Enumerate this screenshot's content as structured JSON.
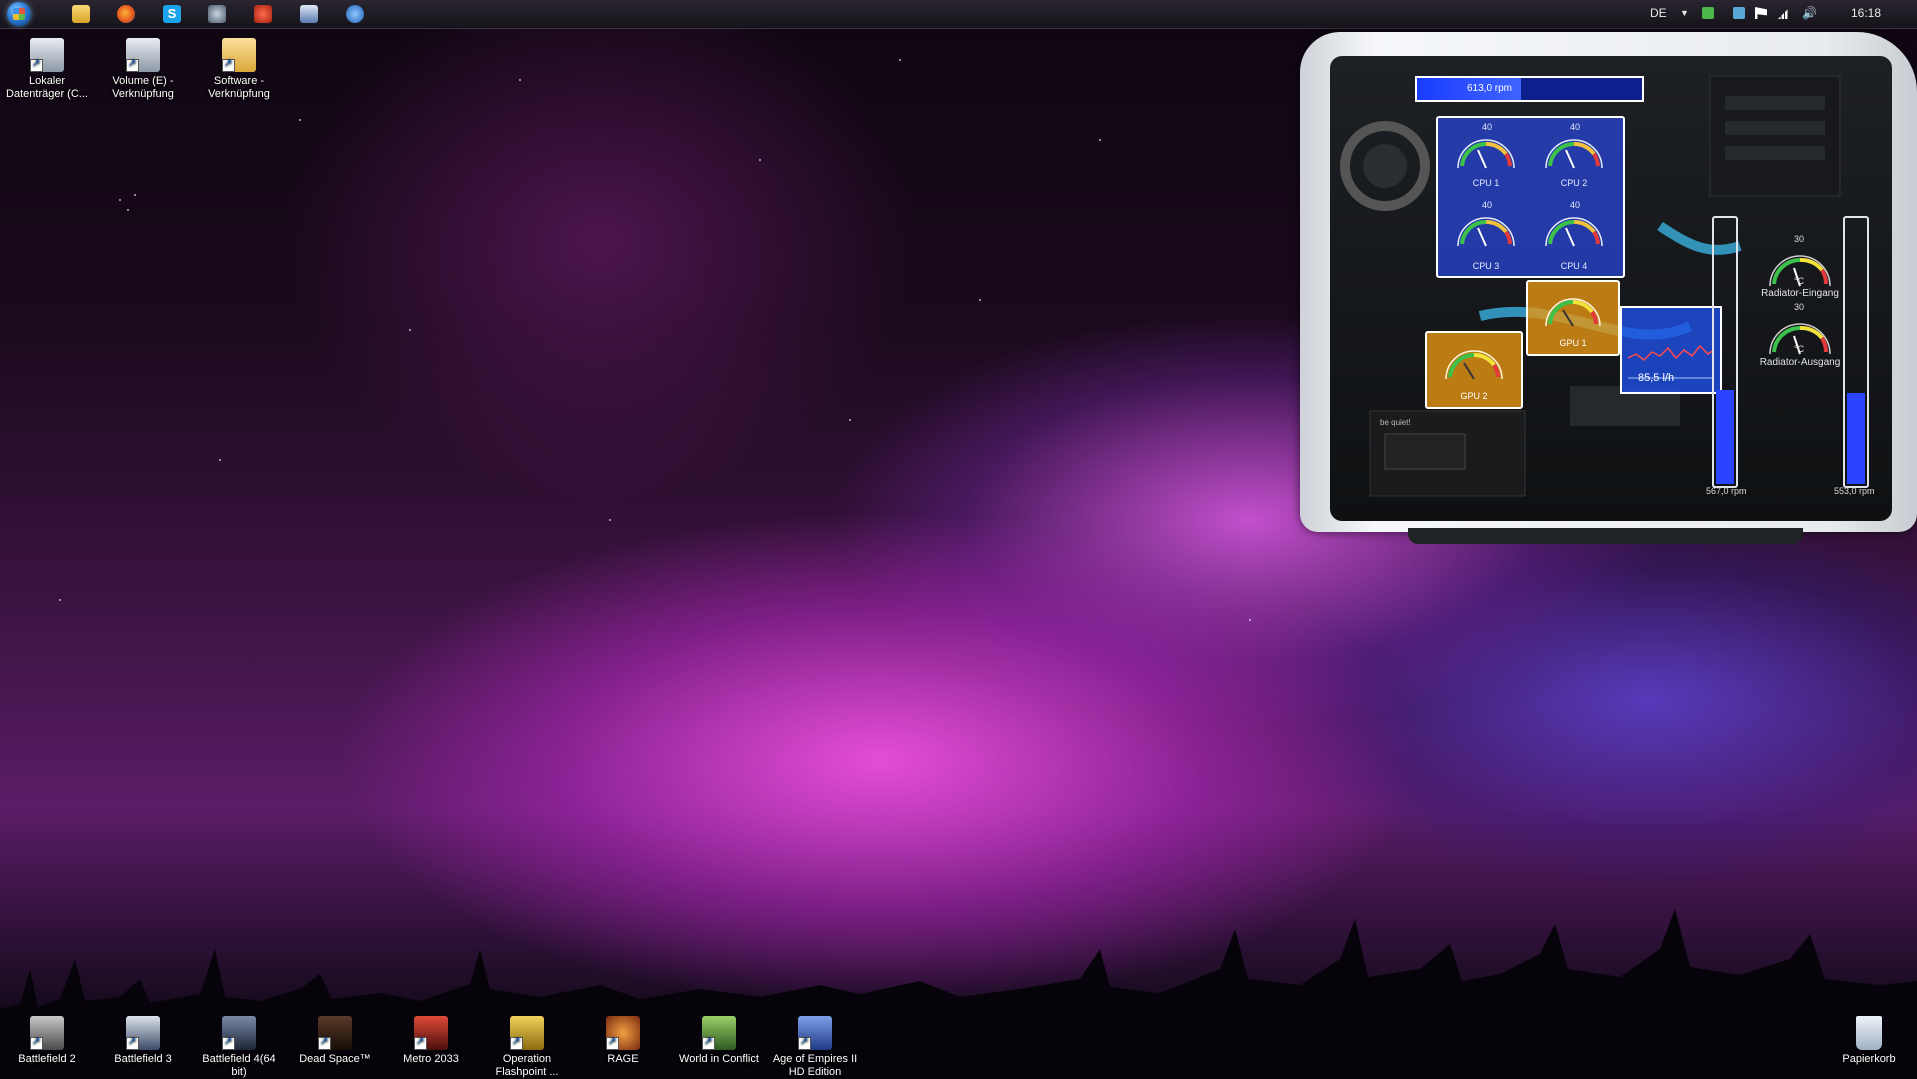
{
  "taskbar": {
    "language": "DE",
    "clock": "16:18",
    "pinned": [
      "explorer-icon",
      "firefox-icon",
      "skype-icon",
      "steam-icon",
      "game-launcher-icon",
      "system-monitor-icon",
      "settings-app-icon"
    ]
  },
  "desktop_top_icons": [
    {
      "label": "Lokaler Datenträger (C..."
    },
    {
      "label": "Volume (E) - Verknüpfung"
    },
    {
      "label": "Software - Verknüpfung"
    }
  ],
  "desktop_bottom_icons": [
    {
      "label": "Battlefield 2"
    },
    {
      "label": "Battlefield 3"
    },
    {
      "label": "Battlefield 4(64 bit)"
    },
    {
      "label": "Dead Space™"
    },
    {
      "label": "Metro 2033"
    },
    {
      "label": "Operation Flashpoint ..."
    },
    {
      "label": "RAGE"
    },
    {
      "label": "World in Conflict"
    },
    {
      "label": "Age of Empires II HD Edition"
    }
  ],
  "recycle_bin": {
    "label": "Papierkorb"
  },
  "monitor": {
    "top_fan": {
      "text": "613,0 rpm",
      "level": 0.46
    },
    "cpu_gauges": [
      {
        "label": "CPU 1"
      },
      {
        "label": "CPU 2"
      },
      {
        "label": "CPU 3"
      },
      {
        "label": "CPU 4"
      }
    ],
    "gpu_gauges": [
      {
        "label": "GPU 1"
      },
      {
        "label": "GPU 2"
      }
    ],
    "gauge_ticks": [
      "0",
      "20",
      "40",
      "60",
      "80"
    ],
    "radiator_ticks": [
      "0",
      "15",
      "30",
      "45",
      "60",
      "70"
    ],
    "unit": "°C",
    "flow": {
      "text": "85,5 l/h"
    },
    "radiator_in": {
      "label": "Radiator-Eingang"
    },
    "radiator_out": {
      "label": "Radiator-Ausgang"
    },
    "left_fan": {
      "text": "567,0 rpm",
      "level": 0.35
    },
    "right_fan": {
      "text": "553,0 rpm",
      "level": 0.34
    },
    "psu_brand": "be quiet!"
  },
  "colors": {
    "accent_blue": "#2a44ff",
    "gauge_amber": "#e6961a",
    "panel_blue": "#2846dc"
  }
}
